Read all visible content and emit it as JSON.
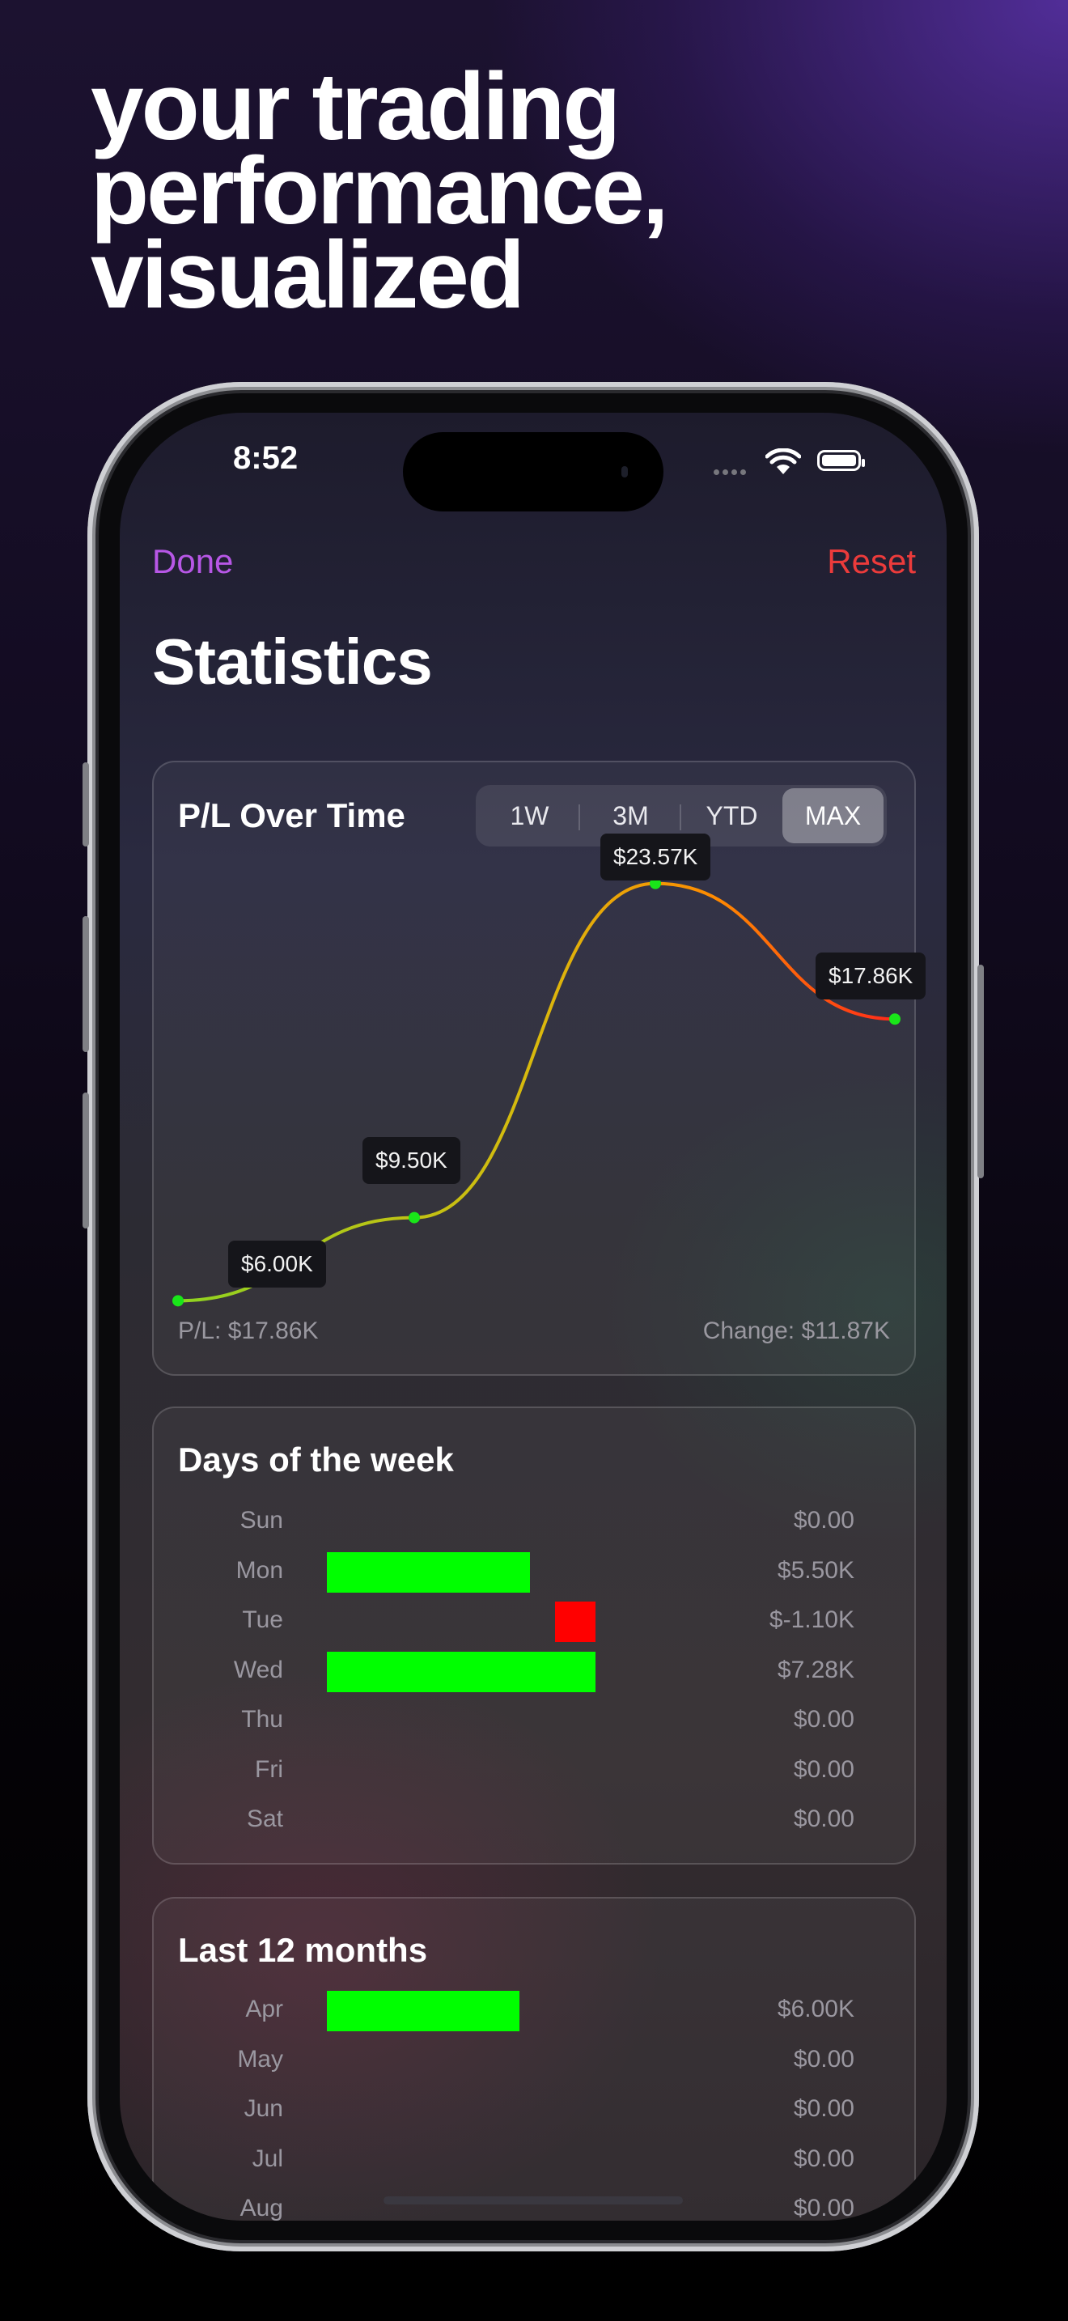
{
  "headline": [
    "your trading",
    "performance,",
    "visualized"
  ],
  "status_bar": {
    "time": "8:52"
  },
  "nav": {
    "done": "Done",
    "reset": "Reset"
  },
  "page_title": "Statistics",
  "pl_card": {
    "title": "P/L Over Time",
    "ranges": [
      "1W",
      "3M",
      "YTD",
      "MAX"
    ],
    "selected_range": "MAX",
    "pl_label": "P/L: $17.86K",
    "change_label": "Change: $11.87K"
  },
  "chart_data": {
    "type": "line",
    "x": [
      0,
      1,
      2,
      3
    ],
    "values": [
      6000,
      9500,
      23570,
      17860
    ],
    "labels": [
      "$6.00K",
      "$9.50K",
      "$23.57K",
      "$17.86K"
    ],
    "point_color": "#19e619",
    "line_gradient": [
      "#8fd321",
      "#d9b90d",
      "#ff8a00",
      "#ff2a1a"
    ]
  },
  "days_card": {
    "title": "Days of the week",
    "rows": [
      {
        "label": "Sun",
        "value": "$0.00",
        "amount": 0
      },
      {
        "label": "Mon",
        "value": "$5.50K",
        "amount": 5500
      },
      {
        "label": "Tue",
        "value": "$-1.10K",
        "amount": -1100
      },
      {
        "label": "Wed",
        "value": "$7.28K",
        "amount": 7280
      },
      {
        "label": "Thu",
        "value": "$0.00",
        "amount": 0
      },
      {
        "label": "Fri",
        "value": "$0.00",
        "amount": 0
      },
      {
        "label": "Sat",
        "value": "$0.00",
        "amount": 0
      }
    ]
  },
  "months_card": {
    "title": "Last 12 months",
    "rows": [
      {
        "label": "Apr",
        "value": "$6.00K",
        "amount": 6000
      },
      {
        "label": "May",
        "value": "$0.00",
        "amount": 0
      },
      {
        "label": "Jun",
        "value": "$0.00",
        "amount": 0
      },
      {
        "label": "Jul",
        "value": "$0.00",
        "amount": 0
      },
      {
        "label": "Aug",
        "value": "$0.00",
        "amount": 0
      }
    ]
  },
  "colors": {
    "positive": "#00ff00",
    "negative": "#ff0000",
    "accent": "#b757e6",
    "destructive": "#ec3b3b"
  }
}
